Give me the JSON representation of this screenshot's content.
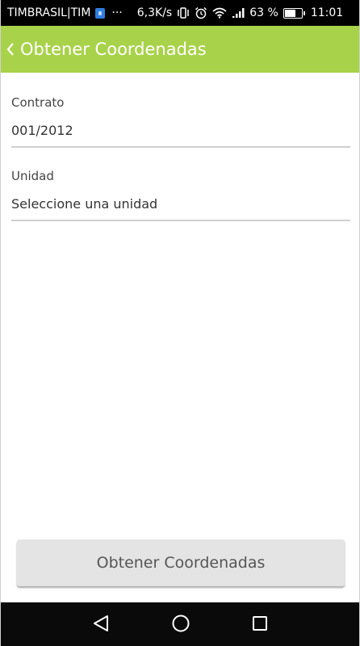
{
  "status_bar": {
    "carrier": "TIMBRASIL|TIM",
    "dots": "···",
    "speed": "6,3K/s",
    "battery_percent": "63 %",
    "time": "11:01",
    "icons": [
      "shield-icon",
      "vibrate-icon",
      "alarm-icon",
      "wifi-icon",
      "signal-icon",
      "battery-icon"
    ]
  },
  "app_bar": {
    "title": "Obtener Coordenadas",
    "back_icon": "chevron-left-icon",
    "color": "#a8d24a"
  },
  "form": {
    "contract": {
      "label": "Contrato",
      "value": "001/2012"
    },
    "unit": {
      "label": "Unidad",
      "value": "Seleccione una unidad"
    }
  },
  "action_button": {
    "label": "Obtener Coordenadas"
  },
  "nav_bar": {
    "buttons": [
      "back-triangle-icon",
      "home-circle-icon",
      "recents-square-icon"
    ]
  }
}
